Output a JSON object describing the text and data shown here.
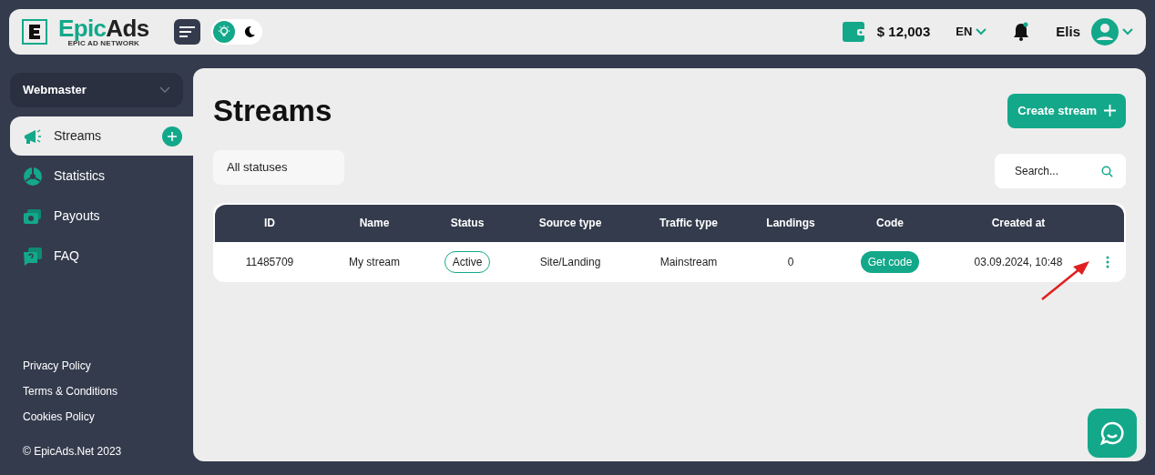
{
  "brand": {
    "part1": "Epic",
    "part2": "Ads",
    "tagline": "EPIC AD NETWORK"
  },
  "theme_toggle": [
    {
      "kind": "light",
      "selected": true
    },
    {
      "kind": "dark",
      "selected": false
    }
  ],
  "header": {
    "balance": "$ 12,003",
    "language": "EN",
    "notification_dot": true,
    "user": "Elis"
  },
  "role_select": {
    "value": "Webmaster"
  },
  "sidebar": {
    "items": [
      {
        "kind": "streams",
        "label": "Streams",
        "selected": true
      },
      {
        "kind": "statistics",
        "label": "Statistics",
        "selected": false
      },
      {
        "kind": "payouts",
        "label": "Payouts",
        "selected": false
      },
      {
        "kind": "faq",
        "label": "FAQ",
        "selected": false
      }
    ],
    "links": [
      "Privacy Policy",
      "Terms & Conditions",
      "Cookies Policy"
    ],
    "copyright": "© EpicAds.Net 2023"
  },
  "page": {
    "title": "Streams",
    "create_button": "Create stream",
    "status_filter": "All statuses",
    "search": {
      "placeholder": "Search..."
    }
  },
  "table": {
    "columns": [
      "ID",
      "Name",
      "Status",
      "Source type",
      "Traffic type",
      "Landings",
      "Code",
      "Created at"
    ],
    "rows": [
      {
        "id": "11485709",
        "name": "My stream",
        "status": "Active",
        "source_type": "Site/Landing",
        "traffic_type": "Mainstream",
        "landings": "0",
        "code": "Get code",
        "created_at": "03.09.2024, 10:48"
      }
    ]
  }
}
